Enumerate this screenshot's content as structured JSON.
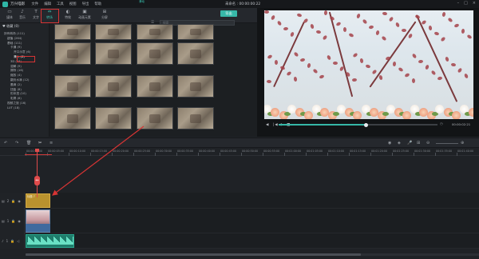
{
  "titlebar": {
    "app_name": "万兴喵影",
    "menus": [
      "文件",
      "编辑",
      "工具",
      "视图",
      "导出",
      "帮助"
    ],
    "document_title": "未命名 : 00:00:00:22"
  },
  "toolbar": {
    "tools": [
      {
        "icon": "folder-icon",
        "label": "媒体"
      },
      {
        "icon": "music-icon",
        "label": "音乐"
      },
      {
        "icon": "text-icon",
        "label": "文字"
      },
      {
        "icon": "transition-icon",
        "label": "转场"
      },
      {
        "icon": "effects-icon",
        "label": "特效"
      },
      {
        "icon": "element-icon",
        "label": "动画元素"
      },
      {
        "icon": "split-screen-icon",
        "label": "分屏"
      }
    ],
    "active_index": 3,
    "export_label": "导出"
  },
  "sidebar": {
    "header": "收藏 (0)",
    "items": [
      {
        "label": "所有转场 (111)",
        "indent": 0
      },
      {
        "label": "超值 (264)",
        "indent": 1
      },
      {
        "label": "基础 (111)",
        "indent": 1
      },
      {
        "label": "卡通 (9)",
        "indent": 2
      },
      {
        "label": "开口示意 (6)",
        "indent": 3
      },
      {
        "label": "滑入 (6)",
        "indent": 3,
        "selected": true
      },
      {
        "label": "3D (18)",
        "indent": 2
      },
      {
        "label": "溶解 (9)",
        "indent": 2
      },
      {
        "label": "擦除 (16)",
        "indent": 2
      },
      {
        "label": "缩放 (4)",
        "indent": 2
      },
      {
        "label": "翻页水滴 (12)",
        "indent": 2
      },
      {
        "label": "墨滴 (2)",
        "indent": 2
      },
      {
        "label": "扭曲 (8)",
        "indent": 2
      },
      {
        "label": "形状扭 (10)",
        "indent": 2
      },
      {
        "label": "彩屏 (6)",
        "indent": 2
      },
      {
        "label": "视频之旅 (16)",
        "indent": 1
      },
      {
        "label": "LUT (18)",
        "indent": 1
      }
    ]
  },
  "library": {
    "search_placeholder": "搜索",
    "thumbnails": [
      "",
      "",
      "",
      "",
      "",
      "",
      "",
      "",
      "",
      "",
      "",
      "",
      "",
      "",
      "",
      "",
      "",
      "",
      ""
    ],
    "captions": [
      "",
      "",
      "",
      "",
      "",
      "",
      "",
      "",
      "",
      "",
      "",
      "",
      "",
      "",
      "滑动"
    ],
    "selected_caption_index": 14
  },
  "preview": {
    "timecode": "00:00:02:21",
    "progress": 0.55
  },
  "timeline": {
    "ruler": [
      "00:00:00:00",
      "00:00:05:00",
      "00:00:10:00",
      "00:00:15:00",
      "00:00:20:00",
      "00:00:25:00",
      "00:00:30:00",
      "00:00:35:00",
      "00:00:40:00",
      "00:00:45:00",
      "00:00:50:00",
      "00:00:55:00",
      "00:01:00:00",
      "00:01:05:00",
      "00:01:10:00",
      "00:01:15:00",
      "00:01:20:00",
      "00:01:25:00",
      "00:01:30:00",
      "00:01:35:00",
      "00:01:40:00"
    ],
    "tracks": [
      {
        "label": "2",
        "type": "title"
      },
      {
        "label": "1",
        "type": "video"
      },
      {
        "label": "1",
        "type": "audio"
      }
    ],
    "title_clip_name": "标题 7",
    "playhead_icon": "↔"
  },
  "colors": {
    "accent": "#37b8a8",
    "annotation": "#d73434",
    "title_clip": "#b9922e",
    "audio_clip": "#1f7d6b"
  }
}
